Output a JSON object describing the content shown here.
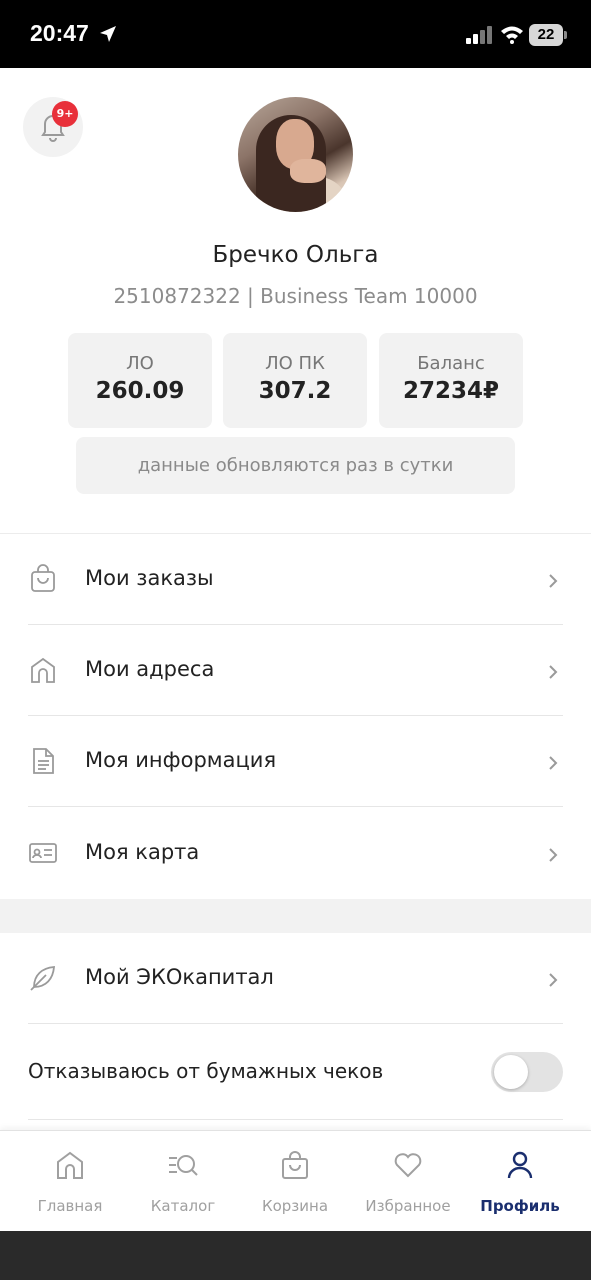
{
  "status_bar": {
    "time": "20:47",
    "battery": "22"
  },
  "notifications": {
    "badge": "9+"
  },
  "profile": {
    "name": "Бречко Ольга",
    "id_line": "2510872322 | Business Team 10000",
    "stats": [
      {
        "label": "ЛО",
        "value": "260.09"
      },
      {
        "label": "ЛО ПК",
        "value": "307.2"
      },
      {
        "label": "Баланс",
        "value": "27234₽"
      }
    ],
    "update_note": "данные обновляются раз в сутки"
  },
  "menu": {
    "items": [
      {
        "label": "Мои заказы",
        "icon": "bag-icon"
      },
      {
        "label": "Мои адреса",
        "icon": "home-icon"
      },
      {
        "label": "Моя информация",
        "icon": "document-icon"
      },
      {
        "label": "Моя карта",
        "icon": "id-card-icon"
      }
    ],
    "eco": {
      "label": "Мой ЭКОкапитал",
      "icon": "leaf-icon"
    },
    "paper_receipts": {
      "label": "Отказываюсь от бумажных чеков",
      "enabled": false
    }
  },
  "tab_bar": {
    "tabs": [
      {
        "label": "Главная",
        "icon": "home-icon",
        "active": false
      },
      {
        "label": "Каталог",
        "icon": "catalog-search-icon",
        "active": false
      },
      {
        "label": "Корзина",
        "icon": "cart-bag-icon",
        "active": false
      },
      {
        "label": "Избранное",
        "icon": "heart-icon",
        "active": false
      },
      {
        "label": "Профиль",
        "icon": "user-icon",
        "active": true
      }
    ],
    "active_color": "#1a2e6e"
  },
  "colors": {
    "badge": "#e8303a",
    "card_bg": "#f2f2f2"
  }
}
